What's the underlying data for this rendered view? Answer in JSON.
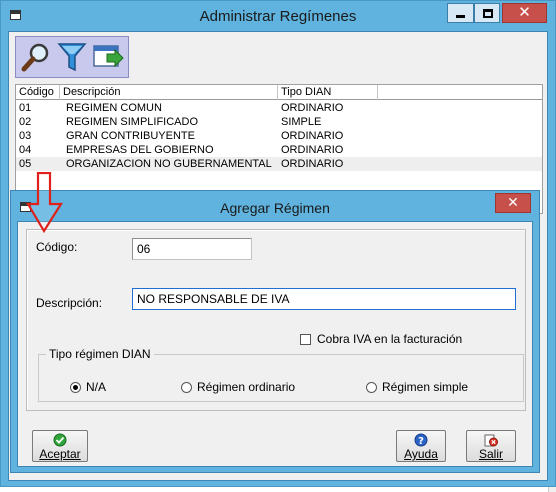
{
  "main_window": {
    "title": "Administrar Regímenes",
    "close_glyph": "✕"
  },
  "toolbar": {
    "icons": [
      "search-icon",
      "filter-icon",
      "export-icon"
    ]
  },
  "grid": {
    "columns": [
      "Código",
      "Descripción",
      "Tipo DIAN"
    ],
    "rows": [
      {
        "code": "01",
        "description": "REGIMEN COMUN",
        "tipo": "ORDINARIO"
      },
      {
        "code": "02",
        "description": "REGIMEN SIMPLIFICADO",
        "tipo": "SIMPLE"
      },
      {
        "code": "03",
        "description": "GRAN CONTRIBUYENTE",
        "tipo": "ORDINARIO"
      },
      {
        "code": "04",
        "description": "EMPRESAS DEL GOBIERNO",
        "tipo": "ORDINARIO"
      },
      {
        "code": "05",
        "description": "ORGANIZACION NO GUBERNAMENTAL",
        "tipo": "ORDINARIO"
      }
    ]
  },
  "dialog": {
    "title": "Agregar Régimen",
    "close_glyph": "✕",
    "codigo_label": "Código:",
    "codigo_value": "06",
    "descripcion_label": "Descripción:",
    "descripcion_value": "NO RESPONSABLE DE IVA",
    "cobra_iva_label": "Cobra IVA en la facturación",
    "cobra_iva_checked": false,
    "tipo_group_label": "Tipo régimen DIAN",
    "radio_na": "N/A",
    "radio_ordinario": "Régimen ordinario",
    "radio_simple": "Régimen simple",
    "selected_radio": "N/A",
    "btn_aceptar": "Aceptar",
    "btn_ayuda": "Ayuda",
    "btn_salir": "Salir"
  },
  "colors": {
    "window_frame": "#5fb3de",
    "close_button": "#c7504a",
    "toolbar_bg": "#c9c9ed",
    "annotation_arrow": "#e0201a"
  }
}
